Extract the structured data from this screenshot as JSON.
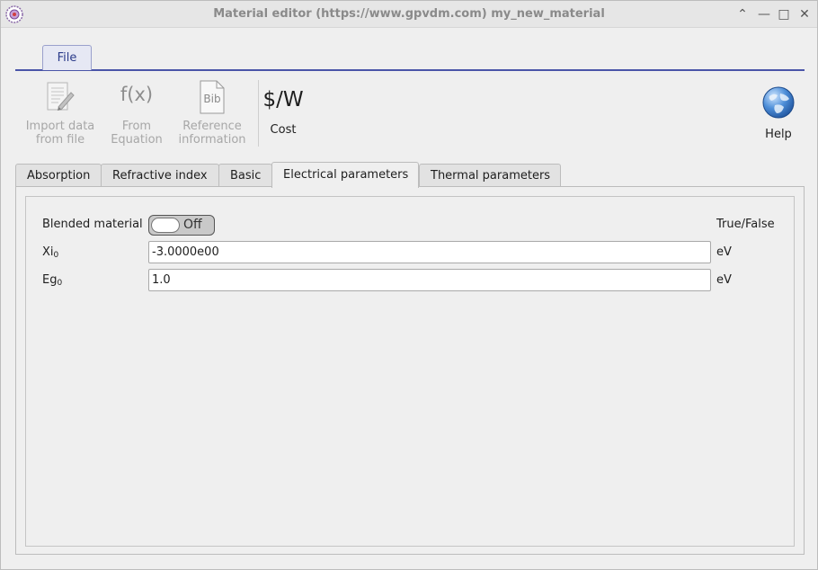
{
  "window": {
    "title": "Material editor (https://www.gpvdm.com) my_new_material"
  },
  "ribbon": {
    "file_tab": "File",
    "tools": [
      {
        "name": "import",
        "line1": "Import data",
        "line2": "from file",
        "icon": "document-edit-icon",
        "enabled": false
      },
      {
        "name": "equation",
        "line1": "From",
        "line2": "Equation",
        "icon": "function-icon",
        "glyph": "f(x)",
        "enabled": false
      },
      {
        "name": "reference",
        "line1": "Reference",
        "line2": "information",
        "icon": "bib-document-icon",
        "glyph": "Bib",
        "enabled": false
      }
    ],
    "cost": {
      "glyph": "$/W",
      "label": "Cost"
    },
    "help": {
      "label": "Help",
      "icon": "globe-icon"
    }
  },
  "tabs": [
    {
      "label": "Absorption",
      "active": false
    },
    {
      "label": "Refractive index",
      "active": false
    },
    {
      "label": "Basic",
      "active": false
    },
    {
      "label": "Electrical parameters",
      "active": true
    },
    {
      "label": "Thermal parameters",
      "active": false
    }
  ],
  "params": {
    "blended": {
      "label": "Blended material",
      "state": "Off",
      "unit": "True/False"
    },
    "xi": {
      "label": "Xi",
      "sub": "0",
      "value": "-3.0000e00",
      "unit": "eV"
    },
    "eg": {
      "label": "Eg",
      "sub": "0",
      "value": "1.0",
      "unit": "eV"
    }
  },
  "colors": {
    "accent": "#4a55a8",
    "disabled_text": "#a7a7a7"
  }
}
